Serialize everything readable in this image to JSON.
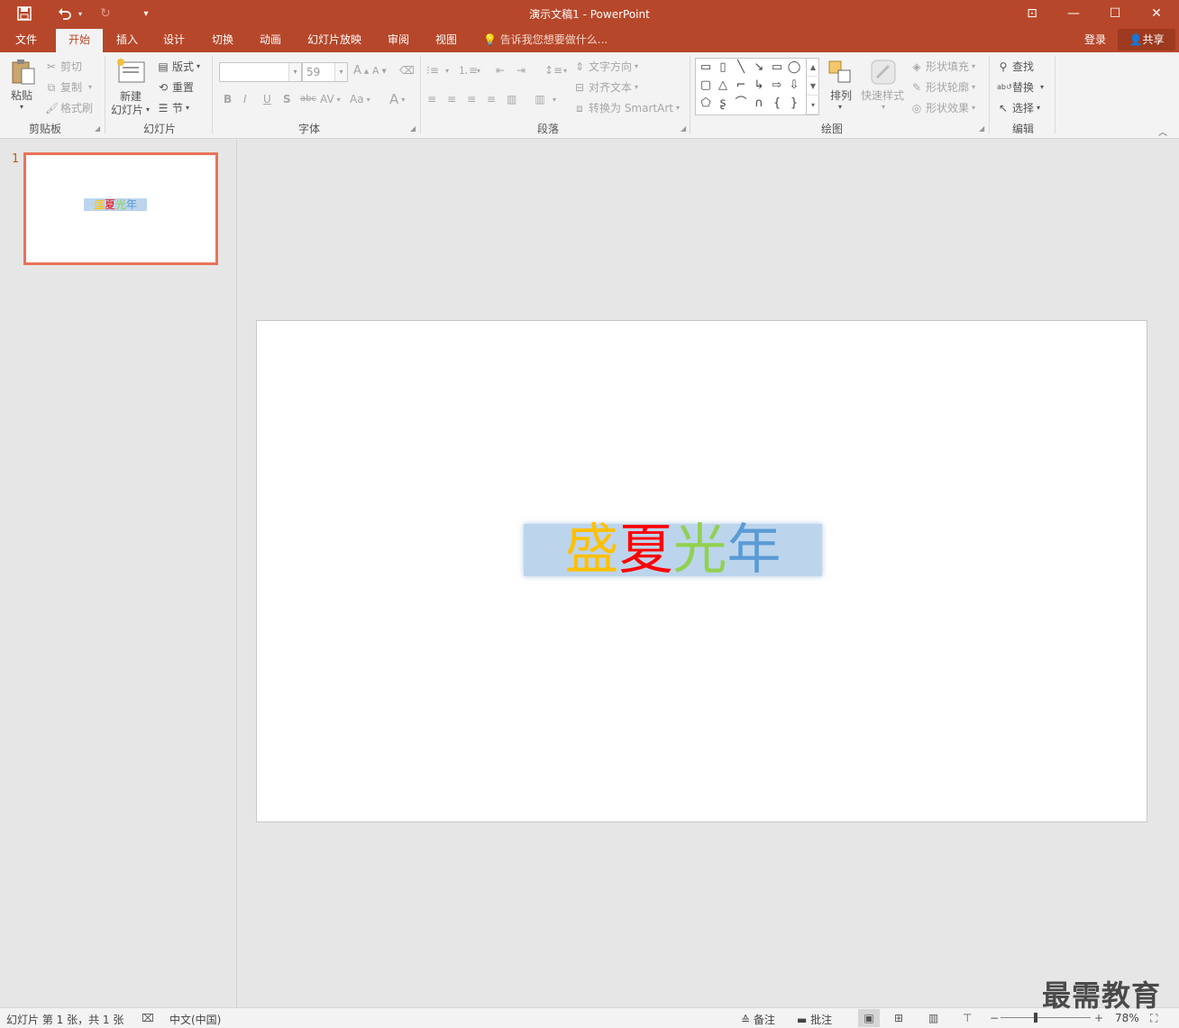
{
  "window": {
    "title": "演示文稿1 - PowerPoint",
    "quick_access": {
      "save_icon": "save-icon",
      "undo_icon": "undo-icon",
      "redo_icon": "redo-icon",
      "customize_icon": "customize-qat-icon"
    },
    "controls": {
      "ribbon_display": "⊡",
      "minimize": "—",
      "maximize": "☐",
      "close": "✕"
    }
  },
  "tabs": [
    "文件",
    "开始",
    "插入",
    "设计",
    "切换",
    "动画",
    "幻灯片放映",
    "审阅",
    "视图"
  ],
  "active_tab": "开始",
  "tell_me": "告诉我您想要做什么...",
  "account": {
    "login": "登录",
    "share": "共享"
  },
  "ribbon": {
    "clipboard": {
      "paste": "粘贴",
      "cut": "剪切",
      "copy": "复制",
      "format_painter": "格式刷",
      "label": "剪贴板"
    },
    "slides": {
      "new_slide_line1": "新建",
      "new_slide_line2": "幻灯片",
      "layout": "版式",
      "reset": "重置",
      "section": "节",
      "label": "幻灯片"
    },
    "font": {
      "font_name": "",
      "font_size": "59",
      "bold": "B",
      "italic": "I",
      "underline": "U",
      "shadow": "S",
      "strike": "abc",
      "spacing": "AV",
      "case": "Aa",
      "color": "A",
      "grow": "A",
      "shrink": "A",
      "label": "字体"
    },
    "paragraph": {
      "text_direction": "文字方向",
      "align_text": "对齐文本",
      "smartart": "转换为 SmartArt",
      "label": "段落"
    },
    "drawing": {
      "arrange": "排列",
      "quick_styles": "快速样式",
      "shape_fill": "形状填充",
      "shape_outline": "形状轮廓",
      "shape_effects": "形状效果",
      "label": "绘图"
    },
    "editing": {
      "find": "查找",
      "replace": "替换",
      "select": "选择",
      "label": "编辑"
    }
  },
  "thumbnails": [
    {
      "number": "1",
      "title_chars": [
        "盛",
        "夏",
        "光",
        "年"
      ]
    }
  ],
  "slide": {
    "title_chars": [
      "盛",
      "夏",
      "光",
      "年"
    ],
    "title_colors": [
      "#ffc000",
      "#ff0000",
      "#92d050",
      "#5b9bd5"
    ],
    "title_box_fill": "#bcd5ed"
  },
  "status": {
    "slide_info": "幻灯片 第 1 张，共 1 张",
    "language": "中文(中国)",
    "notes": "备注",
    "comments": "批注",
    "zoom": "78%"
  },
  "watermark": "最需教育",
  "colors": {
    "accent": "#b7472a",
    "ribbon_bg": "#f3f3f3",
    "workspace_bg": "#e6e6e6"
  }
}
